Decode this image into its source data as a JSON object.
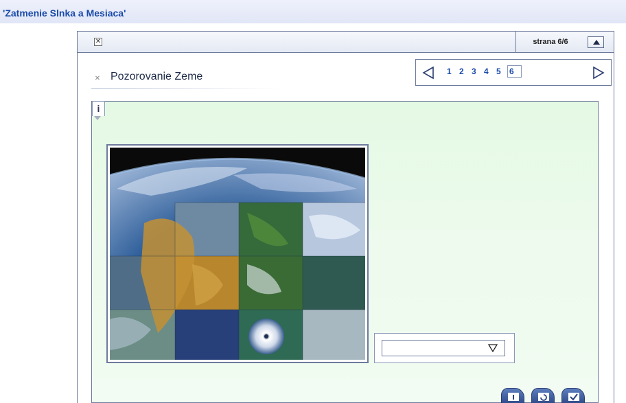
{
  "app": {
    "title": "'Zatmenie Slnka a Mesiaca'"
  },
  "toolbar": {
    "page_label": "strana  6/6",
    "close_icon": "close-icon",
    "collapse_icon": "collapse-up-icon"
  },
  "nav": {
    "pages": [
      "1",
      "2",
      "3",
      "4",
      "5",
      "6"
    ],
    "current_page": "6"
  },
  "section": {
    "title": "Pozorovanie Zeme",
    "info_label": "i"
  },
  "answer": {
    "selected_value": "",
    "dropdown_icon": "chevron-down-icon"
  },
  "actions": [
    {
      "name": "hint-button",
      "icon": "hint-icon"
    },
    {
      "name": "reset-button",
      "icon": "refresh-icon"
    },
    {
      "name": "check-button",
      "icon": "check-icon"
    }
  ],
  "colors": {
    "title": "#1a4aa8",
    "panel_border": "#6d7a9c",
    "content_bg": "#e6f9e6"
  }
}
